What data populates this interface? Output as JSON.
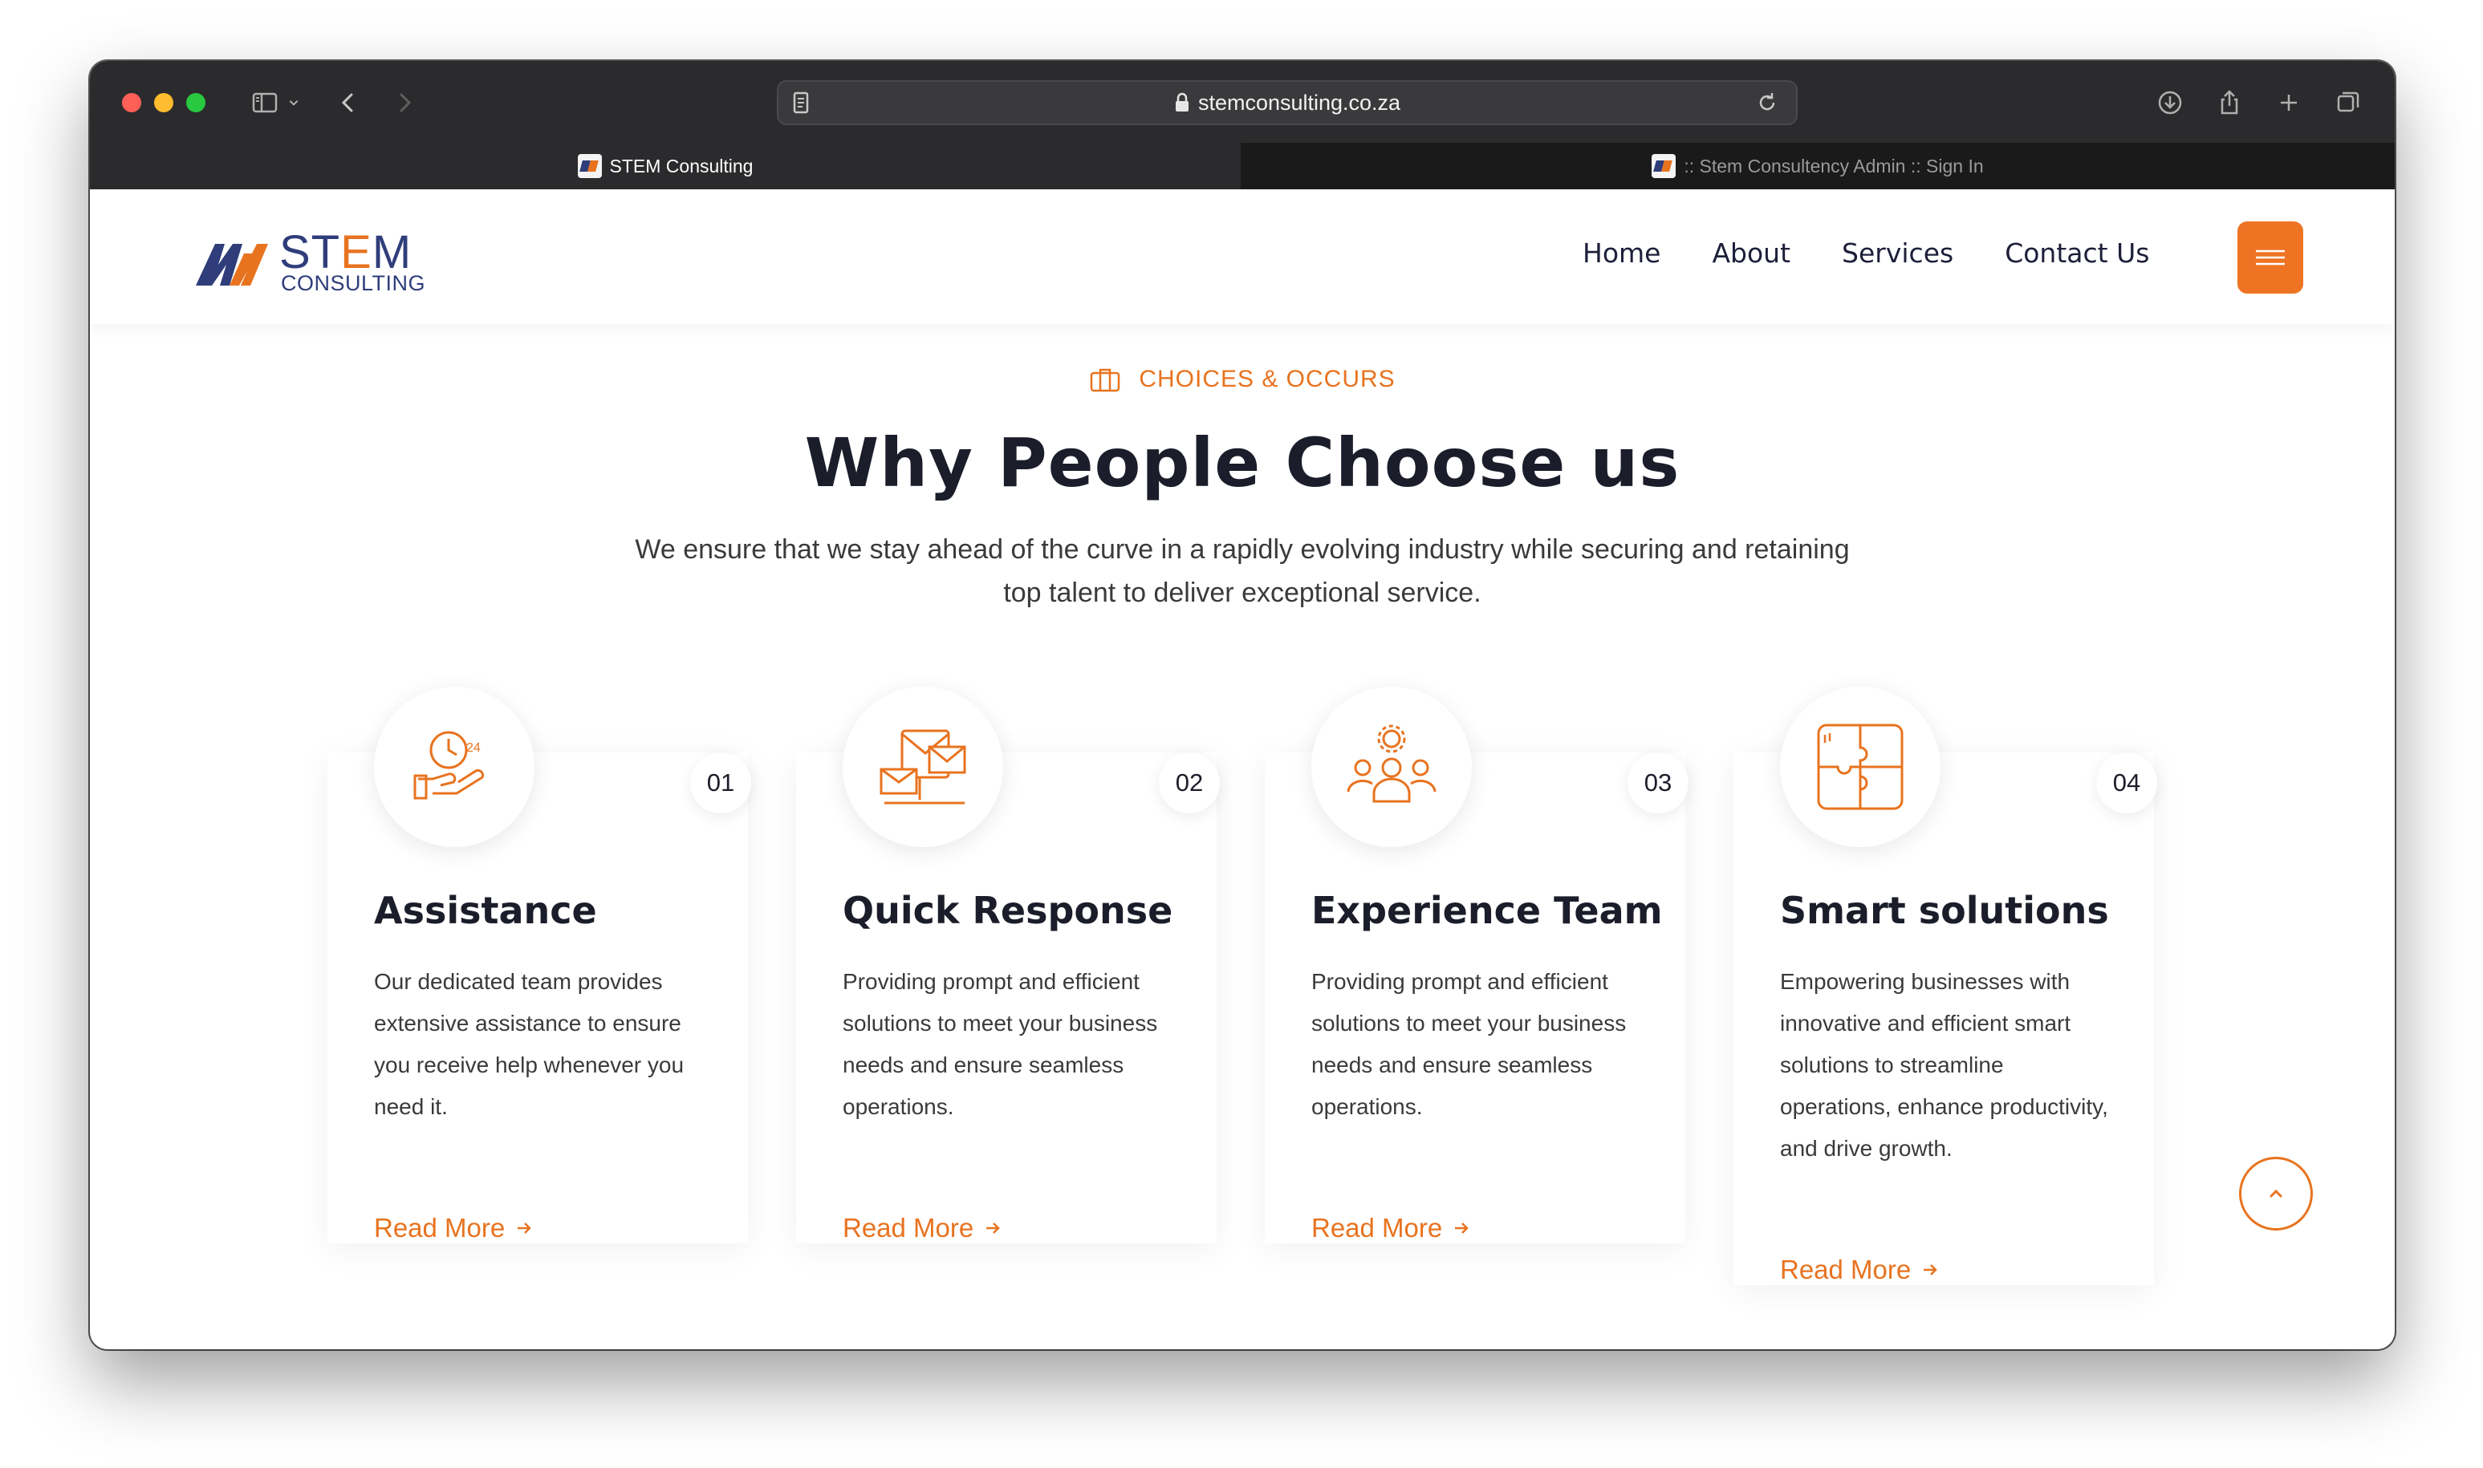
{
  "browser": {
    "url": "stemconsulting.co.za",
    "tabs": [
      {
        "title": "STEM Consulting",
        "active": true
      },
      {
        "title": ":: Stem Consultency Admin :: Sign In",
        "active": false
      }
    ]
  },
  "header": {
    "logo_main_1": "ST",
    "logo_main_accent": "E",
    "logo_main_2": "M",
    "logo_sub": "CONSULTING",
    "nav": [
      "Home",
      "About",
      "Services",
      "Contact Us"
    ],
    "menu_icon": "hamburger-icon"
  },
  "section": {
    "tag": "CHOICES & OCCURS",
    "title": "Why People Choose us",
    "description": "We ensure that we stay ahead of the curve in a rapidly evolving industry while securing and retaining top talent to deliver exceptional service."
  },
  "cards": [
    {
      "number": "01",
      "title": "Assistance",
      "text": "Our dedicated team provides extensive assistance to ensure you receive help whenever you need it.",
      "link": "Read More",
      "icon": "support-24-hours-icon"
    },
    {
      "number": "02",
      "title": "Quick Response",
      "text": "Providing prompt and efficient solutions to meet your business needs and ensure seamless operations.",
      "link": "Read More",
      "icon": "email-computer-icon"
    },
    {
      "number": "03",
      "title": "Experience Team",
      "text": "Providing prompt and efficient solutions to meet your business needs and ensure seamless operations.",
      "link": "Read More",
      "icon": "team-gear-icon"
    },
    {
      "number": "04",
      "title": "Smart solutions",
      "text": "Empowering businesses with innovative and efficient smart solutions to streamline operations, enhance productivity, and drive growth.",
      "link": "Read More",
      "icon": "puzzle-icon"
    }
  ],
  "colors": {
    "accent": "#e8731f",
    "brand_navy": "#2f3d7a",
    "heading": "#1b1d2a"
  }
}
